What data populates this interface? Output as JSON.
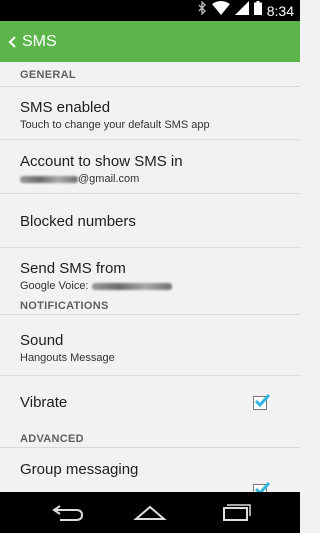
{
  "status": {
    "time": "8:34"
  },
  "appbar": {
    "title": "SMS"
  },
  "sections": {
    "general": "GENERAL",
    "notifications": "NOTIFICATIONS",
    "advanced": "ADVANCED"
  },
  "items": {
    "sms_enabled": {
      "title": "SMS enabled",
      "summary": "Touch to change your default SMS app"
    },
    "account": {
      "title": "Account to show SMS in",
      "summary": "@gmail.com"
    },
    "blocked": {
      "title": "Blocked numbers"
    },
    "send_from": {
      "title": "Send SMS from",
      "summary": "Google Voice:"
    },
    "sound": {
      "title": "Sound",
      "summary": "Hangouts Message"
    },
    "vibrate": {
      "title": "Vibrate",
      "checked": true
    },
    "group": {
      "title": "Group messaging",
      "checked": true
    }
  },
  "colors": {
    "appbar": "#5cb44a",
    "checkmark": "#33b5e5"
  },
  "icons": [
    "bluetooth-icon",
    "wifi-icon",
    "signal-icon",
    "battery-icon",
    "back-arrow-icon",
    "nav-back-icon",
    "nav-home-icon",
    "nav-recents-icon"
  ]
}
